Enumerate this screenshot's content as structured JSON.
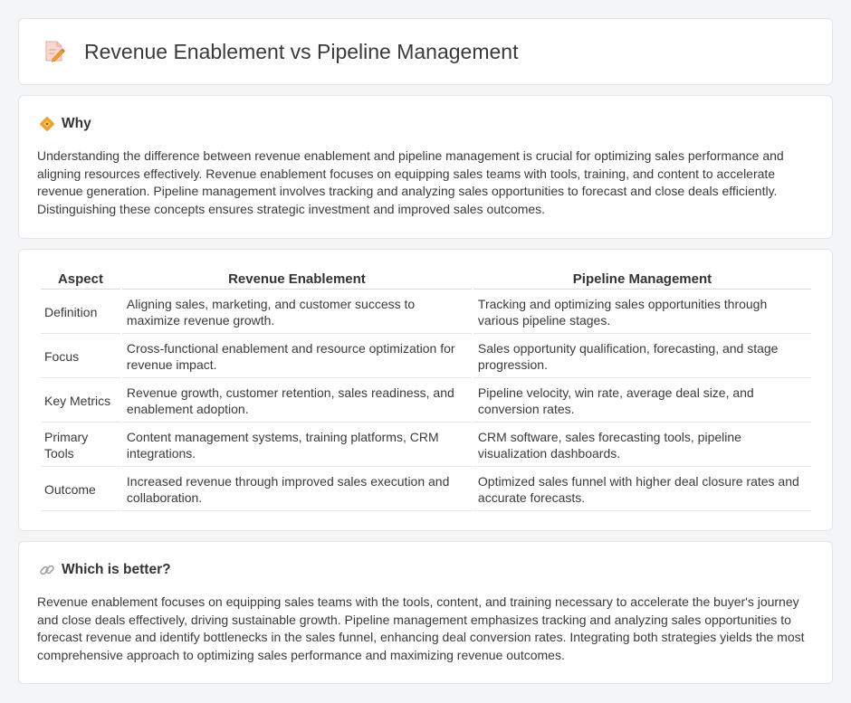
{
  "header": {
    "title": "Revenue Enablement vs Pipeline Management",
    "icon": "document-pencil-icon"
  },
  "why": {
    "icon": "diamond-warning-icon",
    "title": "Why",
    "body": "Understanding the difference between revenue enablement and pipeline management is crucial for optimizing sales performance and aligning resources effectively. Revenue enablement focuses on equipping sales teams with tools, training, and content to accelerate revenue generation. Pipeline management involves tracking and analyzing sales opportunities to forecast and close deals efficiently. Distinguishing these concepts ensures strategic investment and improved sales outcomes."
  },
  "table": {
    "headers": [
      "Aspect",
      "Revenue Enablement",
      "Pipeline Management"
    ],
    "rows": [
      [
        "Definition",
        "Aligning sales, marketing, and customer success to maximize revenue growth.",
        "Tracking and optimizing sales opportunities through various pipeline stages."
      ],
      [
        "Focus",
        "Cross-functional enablement and resource optimization for revenue impact.",
        "Sales opportunity qualification, forecasting, and stage progression."
      ],
      [
        "Key Metrics",
        "Revenue growth, customer retention, sales readiness, and enablement adoption.",
        "Pipeline velocity, win rate, average deal size, and conversion rates."
      ],
      [
        "Primary Tools",
        "Content management systems, training platforms, CRM integrations.",
        "CRM software, sales forecasting tools, pipeline visualization dashboards."
      ],
      [
        "Outcome",
        "Increased revenue through improved sales execution and collaboration.",
        "Optimized sales funnel with higher deal closure rates and accurate forecasts."
      ]
    ]
  },
  "better": {
    "icon": "link-icon",
    "title": "Which is better?",
    "body": "Revenue enablement focuses on equipping sales teams with the tools, content, and training necessary to accelerate the buyer's journey and close deals effectively, driving sustainable growth. Pipeline management emphasizes tracking and analyzing sales opportunities to forecast revenue and identify bottlenecks in the sales funnel, enhancing deal conversion rates. Integrating both strategies yields the most comprehensive approach to optimizing sales performance and maximizing revenue outcomes."
  },
  "colors": {
    "background": "#f4f5f7",
    "card": "#ffffff",
    "border": "#e3e5e8",
    "icon_accent": "#f0a030"
  }
}
